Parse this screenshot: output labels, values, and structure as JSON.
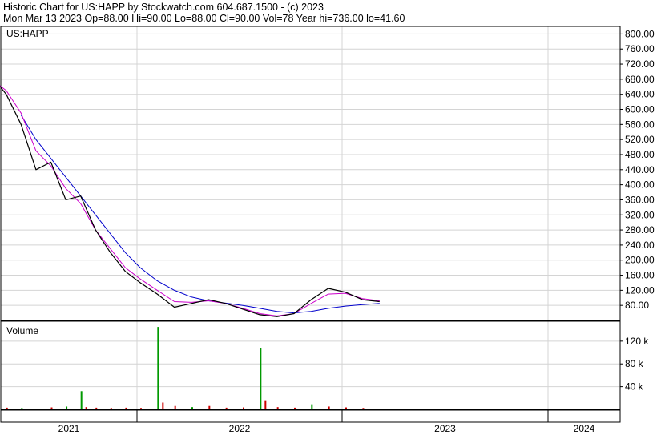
{
  "header": {
    "line1": "Historic Chart for US:HAPP by Stockwatch.com 604.687.1500 - (c) 2023",
    "line2": "Mon Mar 13 2023   Op=88.00  Hi=90.00  Lo=88.00  Cl=90.00  Vol=78  Year hi=736.00  lo=41.60"
  },
  "chart_data": [
    {
      "type": "line",
      "title": "US:HAPP",
      "ylim": [
        40,
        820
      ],
      "yticks": [
        "800.00",
        "760.00",
        "720.00",
        "680.00",
        "640.00",
        "600.00",
        "560.00",
        "520.00",
        "480.00",
        "440.00",
        "400.00",
        "360.00",
        "320.00",
        "280.00",
        "240.00",
        "200.00",
        "160.00",
        "120.00",
        "80.00"
      ],
      "x_labels": [
        "2021",
        "2022",
        "2023",
        "2024"
      ],
      "grid": true,
      "price_series": {
        "name": "",
        "color": "#000000",
        "points": [
          [
            "2021-03",
            690
          ],
          [
            "2021-04",
            640
          ],
          [
            "2021-05",
            560
          ],
          [
            "2021-06",
            440
          ],
          [
            "2021-07",
            460
          ],
          [
            "2021-08",
            360
          ],
          [
            "2021-09",
            370
          ],
          [
            "2021-10",
            280
          ],
          [
            "2021-11",
            220
          ],
          [
            "2021-12",
            170
          ],
          [
            "2022-01",
            140
          ],
          [
            "2022-02",
            110
          ],
          [
            "2022-03",
            75
          ],
          [
            "2022-04",
            85
          ],
          [
            "2022-05",
            95
          ],
          [
            "2022-06",
            85
          ],
          [
            "2022-07",
            70
          ],
          [
            "2022-08",
            55
          ],
          [
            "2022-09",
            50
          ],
          [
            "2022-10",
            58
          ],
          [
            "2022-11",
            95
          ],
          [
            "2022-12",
            125
          ],
          [
            "2023-01",
            115
          ],
          [
            "2023-02",
            95
          ],
          [
            "2023-03",
            90
          ]
        ]
      },
      "ma_short": {
        "name": "",
        "color": "#cc00cc",
        "points": [
          [
            "2021-03",
            680
          ],
          [
            "2021-04",
            650
          ],
          [
            "2021-05",
            590
          ],
          [
            "2021-06",
            490
          ],
          [
            "2021-07",
            450
          ],
          [
            "2021-08",
            390
          ],
          [
            "2021-09",
            350
          ],
          [
            "2021-10",
            280
          ],
          [
            "2021-11",
            230
          ],
          [
            "2021-12",
            180
          ],
          [
            "2022-01",
            150
          ],
          [
            "2022-02",
            120
          ],
          [
            "2022-03",
            90
          ],
          [
            "2022-04",
            88
          ],
          [
            "2022-05",
            92
          ],
          [
            "2022-06",
            85
          ],
          [
            "2022-07",
            72
          ],
          [
            "2022-08",
            58
          ],
          [
            "2022-09",
            52
          ],
          [
            "2022-10",
            58
          ],
          [
            "2022-11",
            85
          ],
          [
            "2022-12",
            110
          ],
          [
            "2023-01",
            112
          ],
          [
            "2023-02",
            98
          ],
          [
            "2023-03",
            92
          ]
        ]
      },
      "ma_long": {
        "name": "",
        "color": "#0000cc",
        "points": [
          [
            "2021-05",
            585
          ],
          [
            "2021-06",
            520
          ],
          [
            "2021-07",
            470
          ],
          [
            "2021-08",
            420
          ],
          [
            "2021-09",
            370
          ],
          [
            "2021-10",
            320
          ],
          [
            "2021-11",
            270
          ],
          [
            "2021-12",
            220
          ],
          [
            "2022-01",
            180
          ],
          [
            "2022-02",
            145
          ],
          [
            "2022-03",
            120
          ],
          [
            "2022-04",
            102
          ],
          [
            "2022-05",
            92
          ],
          [
            "2022-06",
            86
          ],
          [
            "2022-07",
            80
          ],
          [
            "2022-08",
            72
          ],
          [
            "2022-09",
            64
          ],
          [
            "2022-10",
            60
          ],
          [
            "2022-11",
            64
          ],
          [
            "2022-12",
            72
          ],
          [
            "2023-01",
            78
          ],
          [
            "2023-02",
            82
          ],
          [
            "2023-03",
            85
          ]
        ]
      }
    },
    {
      "type": "bar",
      "title": "Volume",
      "ylim": [
        0,
        155000
      ],
      "yticks": [
        "120 k",
        "80 k",
        "40 k"
      ],
      "bars": [
        {
          "date": "2021-03",
          "value": 4000,
          "color": "#cc0000"
        },
        {
          "date": "2021-03",
          "value": 18000,
          "color": "#cc0000"
        },
        {
          "date": "2021-04",
          "value": 3000,
          "color": "#cc0000"
        },
        {
          "date": "2021-05",
          "value": 2500,
          "color": "#009900"
        },
        {
          "date": "2021-07",
          "value": 3500,
          "color": "#cc0000"
        },
        {
          "date": "2021-08",
          "value": 5000,
          "color": "#009900"
        },
        {
          "date": "2021-09",
          "value": 32000,
          "color": "#009900"
        },
        {
          "date": "2021-09",
          "value": 4000,
          "color": "#cc0000"
        },
        {
          "date": "2021-10",
          "value": 3000,
          "color": "#cc0000"
        },
        {
          "date": "2021-11",
          "value": 2500,
          "color": "#cc0000"
        },
        {
          "date": "2021-12",
          "value": 3000,
          "color": "#cc0000"
        },
        {
          "date": "2022-01",
          "value": 2500,
          "color": "#cc0000"
        },
        {
          "date": "2022-02",
          "value": 145000,
          "color": "#009900"
        },
        {
          "date": "2022-02",
          "value": 12000,
          "color": "#cc0000"
        },
        {
          "date": "2022-03",
          "value": 6000,
          "color": "#cc0000"
        },
        {
          "date": "2022-04",
          "value": 4000,
          "color": "#009900"
        },
        {
          "date": "2022-05",
          "value": 6000,
          "color": "#cc0000"
        },
        {
          "date": "2022-06",
          "value": 3000,
          "color": "#cc0000"
        },
        {
          "date": "2022-07",
          "value": 3500,
          "color": "#cc0000"
        },
        {
          "date": "2022-08",
          "value": 108000,
          "color": "#009900"
        },
        {
          "date": "2022-08",
          "value": 16000,
          "color": "#cc0000"
        },
        {
          "date": "2022-09",
          "value": 4000,
          "color": "#cc0000"
        },
        {
          "date": "2022-10",
          "value": 3000,
          "color": "#cc0000"
        },
        {
          "date": "2022-11",
          "value": 9000,
          "color": "#009900"
        },
        {
          "date": "2022-12",
          "value": 5000,
          "color": "#cc0000"
        },
        {
          "date": "2023-01",
          "value": 3500,
          "color": "#cc0000"
        },
        {
          "date": "2023-02",
          "value": 2500,
          "color": "#cc0000"
        }
      ]
    }
  ]
}
